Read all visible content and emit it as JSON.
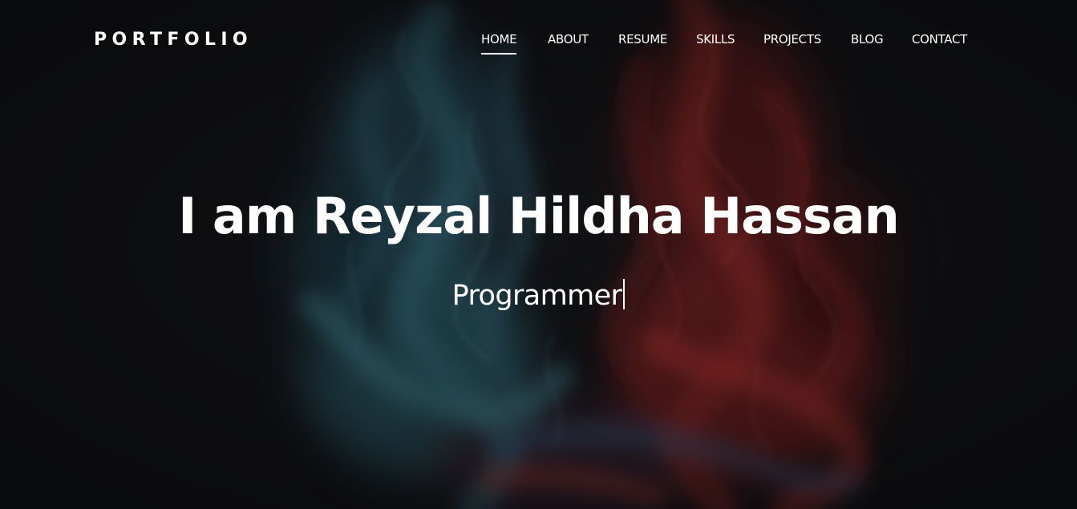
{
  "brand": {
    "name": "PORTFOLIO"
  },
  "nav": {
    "items": [
      {
        "label": "HOME",
        "active": true
      },
      {
        "label": "ABOUT",
        "active": false
      },
      {
        "label": "RESUME",
        "active": false
      },
      {
        "label": "SKILLS",
        "active": false
      },
      {
        "label": "PROJECTS",
        "active": false
      },
      {
        "label": "BLOG",
        "active": false
      },
      {
        "label": "CONTACT",
        "active": false
      }
    ]
  },
  "hero": {
    "title": "I am Reyzal Hildha Hassan",
    "subtitle": "Programmer"
  },
  "colors": {
    "background": "#141518",
    "text": "#ffffff",
    "smoke_blue": "#3f8ea0",
    "smoke_red": "#d23a34"
  }
}
